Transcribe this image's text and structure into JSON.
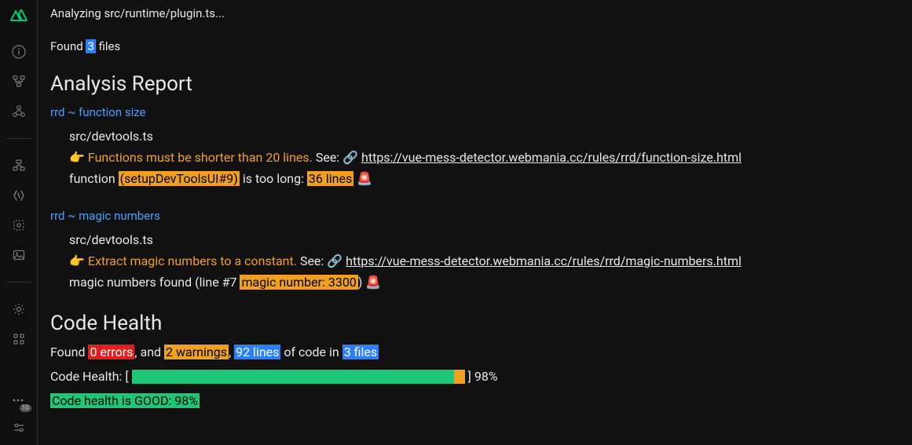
{
  "statusLine": "Analyzing src/runtime/plugin.ts...",
  "foundPrefix": "Found ",
  "foundCount": "3",
  "foundSuffix": " files",
  "analysis": {
    "title": "Analysis Report",
    "rules": [
      {
        "name": "rrd ~ function size",
        "file": "src/devtools.ts",
        "pointer": "👉 ",
        "desc": "Functions must be shorter than 20 lines.",
        "seeLabel": " See: 🔗 ",
        "link": "https://vue-mess-detector.webmania.cc/rules/rrd/function-size.html",
        "detailPrefix": "function ",
        "hl1": "(setupDevToolsUI#9)",
        "detailMid": " is too long: ",
        "hl2": "36 lines",
        "detailSuffix": " 🚨"
      },
      {
        "name": "rrd ~ magic numbers",
        "file": "src/devtools.ts",
        "pointer": "👉 ",
        "desc": "Extract magic numbers to a constant.",
        "seeLabel": " See: 🔗 ",
        "link": "https://vue-mess-detector.webmania.cc/rules/rrd/magic-numbers.html",
        "detailPrefix": "magic numbers found (line #7 ",
        "hl1": "magic number: 3300",
        "detailMid": "",
        "hl2": "",
        "detailSuffix": ") 🚨"
      }
    ]
  },
  "health": {
    "title": "Code Health",
    "foundPrefix": "Found ",
    "errors": "0 errors",
    "sep1": ", and ",
    "warnings": "2 warnings",
    "sep2": ", ",
    "lines": "92 lines",
    "sep3": " of code in ",
    "files": "3 files",
    "barLabel": "Code Health: [",
    "barClose": "] ",
    "percent": "98%",
    "good": "Code health is GOOD: 98%"
  },
  "sidebar": {
    "badge": "10"
  }
}
